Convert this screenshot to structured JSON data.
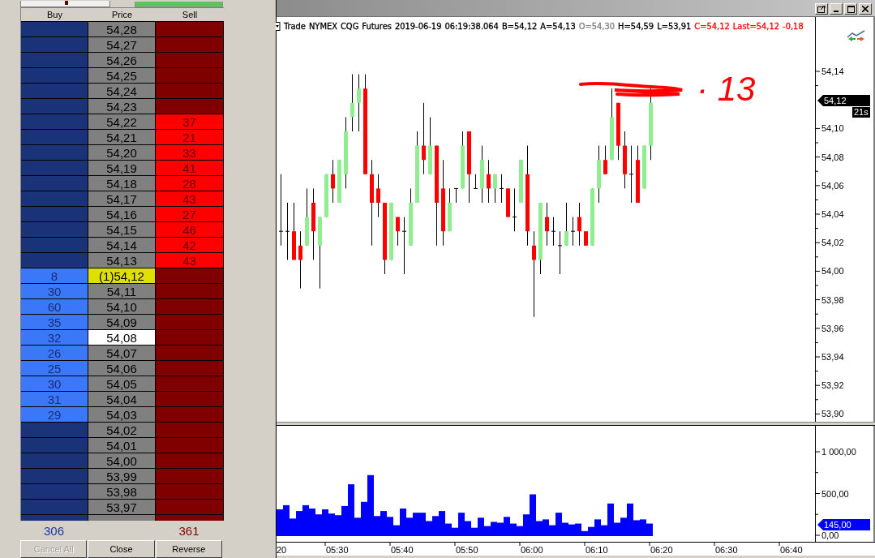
{
  "ladder": {
    "columns": [
      "Buy",
      "Price",
      "Sell"
    ],
    "rows": [
      {
        "price": "54,28",
        "last_price": false,
        "marked": false
      },
      {
        "price": "54,27",
        "last_price": false,
        "marked": false
      },
      {
        "price": "54,26",
        "last_price": false,
        "marked": false
      },
      {
        "price": "54,25",
        "last_price": false,
        "marked": false
      },
      {
        "price": "54,24",
        "last_price": false,
        "marked": false
      },
      {
        "price": "54,23",
        "last_price": false,
        "marked": false
      },
      {
        "price": "54,22",
        "sell": "37",
        "last_price": false,
        "marked": false
      },
      {
        "price": "54,21",
        "sell": "21",
        "last_price": false,
        "marked": false
      },
      {
        "price": "54,20",
        "sell": "33",
        "last_price": false,
        "marked": false
      },
      {
        "price": "54,19",
        "sell": "41",
        "last_price": false,
        "marked": false
      },
      {
        "price": "54,18",
        "sell": "28",
        "last_price": false,
        "marked": false
      },
      {
        "price": "54,17",
        "sell": "43",
        "last_price": false,
        "marked": false
      },
      {
        "price": "54,16",
        "sell": "27",
        "last_price": false,
        "marked": false
      },
      {
        "price": "54,15",
        "sell": "46",
        "last_price": false,
        "marked": false
      },
      {
        "price": "54,14",
        "sell": "42",
        "last_price": false,
        "marked": false
      },
      {
        "price": "54,13",
        "sell": "43",
        "last_price": false,
        "marked": false
      },
      {
        "buy": "8",
        "price": "(1)54,12",
        "last_price": true,
        "marked": false
      },
      {
        "buy": "30",
        "price": "54,11",
        "last_price": false,
        "marked": false
      },
      {
        "buy": "60",
        "price": "54,10",
        "last_price": false,
        "marked": false
      },
      {
        "buy": "35",
        "price": "54,09",
        "last_price": false,
        "marked": false
      },
      {
        "buy": "32",
        "price": "54,08",
        "last_price": false,
        "marked": true
      },
      {
        "buy": "26",
        "price": "54,07",
        "last_price": false,
        "marked": false
      },
      {
        "buy": "25",
        "price": "54,06",
        "last_price": false,
        "marked": false
      },
      {
        "buy": "30",
        "price": "54,05",
        "last_price": false,
        "marked": false
      },
      {
        "buy": "31",
        "price": "54,04",
        "last_price": false,
        "marked": false
      },
      {
        "buy": "29",
        "price": "54,03",
        "last_price": false,
        "marked": false
      },
      {
        "price": "54,02",
        "last_price": false,
        "marked": false
      },
      {
        "price": "54,01",
        "last_price": false,
        "marked": false
      },
      {
        "price": "54,00",
        "last_price": false,
        "marked": false
      },
      {
        "price": "53,99",
        "last_price": false,
        "marked": false
      },
      {
        "price": "53,98",
        "last_price": false,
        "marked": false
      },
      {
        "price": "53,97",
        "last_price": false,
        "marked": false
      }
    ],
    "totals": {
      "buy": "306",
      "sell": "361"
    }
  },
  "buttons": [
    {
      "label": "Cancel All",
      "disabled": true
    },
    {
      "label": "Close",
      "disabled": false
    },
    {
      "label": "Reverse",
      "disabled": false
    }
  ],
  "chart": {
    "info": [
      {
        "text": "Trade",
        "color": "#000000"
      },
      {
        "text": "NYMEX",
        "color": "#000000"
      },
      {
        "text": "CQG",
        "color": "#000000"
      },
      {
        "text": "Futures",
        "color": "#000000"
      },
      {
        "text": "2019-06-19",
        "color": "#000000"
      },
      {
        "text": "06:19:38.064",
        "color": "#000000"
      },
      {
        "text": "B=54,12",
        "color": "#000000"
      },
      {
        "text": "A=54,13",
        "color": "#000000"
      },
      {
        "text": "O=54,30",
        "color": "#808080"
      },
      {
        "text": "H=54,59",
        "color": "#000000"
      },
      {
        "text": "L=53,91",
        "color": "#000000"
      },
      {
        "text": "C=54,12",
        "color": "#ff0000"
      },
      {
        "text": "Last=54,12",
        "color": "#ff0000"
      },
      {
        "text": "-0,18",
        "color": "#ff0000"
      }
    ],
    "annotation": "· 13",
    "price_axis": {
      "labels": [
        "54,14",
        "54,10",
        "54,08",
        "54,06",
        "54,04",
        "54,02",
        "54,00",
        "53,98",
        "53,96",
        "53,94",
        "53,92",
        "53,90"
      ],
      "current_price": "54,12",
      "countdown": "21s"
    },
    "volume_axis": {
      "labels": [
        "1 000,00",
        "500,00",
        "0,00"
      ],
      "current": "145,00"
    },
    "time_axis": [
      "20",
      "05:30",
      "05:40",
      "05:50",
      "06:00",
      "06:10",
      "06:20",
      "06:30",
      "06:40"
    ]
  }
}
